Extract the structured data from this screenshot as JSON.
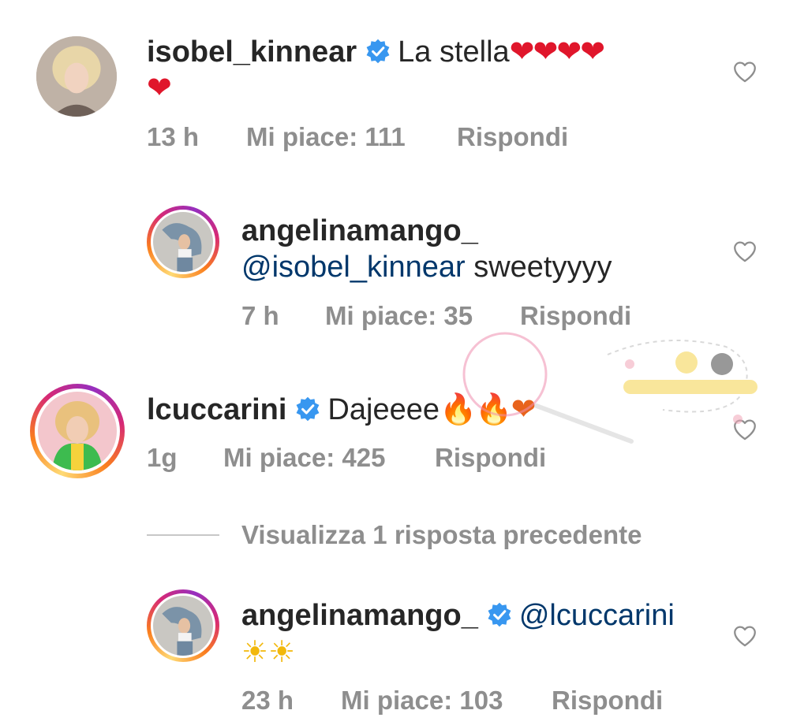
{
  "comments": [
    {
      "username": "isobel_kinnear",
      "verified": true,
      "text": "La stella",
      "emoji_line1": "❤❤❤❤",
      "emoji_line2": "❤",
      "time": "13 h",
      "likes": "Mi piace: 111",
      "reply": "Rispondi"
    },
    {
      "username": "angelinamango_",
      "verified": false,
      "mention": "@isobel_kinnear",
      "text": " sweetyyyy",
      "time": "7 h",
      "likes": "Mi piace: 35",
      "reply": "Rispondi"
    },
    {
      "username": "lcuccarini",
      "verified": true,
      "text": "Dajeeee",
      "emoji": "🔥🔥❤",
      "time": "1g",
      "likes": "Mi piace: 425",
      "reply": "Rispondi"
    },
    {
      "username": "angelinamango_",
      "verified": true,
      "mention": "@lcuccarini",
      "emoji": "☀☀",
      "time": "23 h",
      "likes": "Mi piace: 103",
      "reply": "Rispondi"
    }
  ],
  "view_previous": "Visualizza 1 risposta precedente",
  "colors": {
    "text": "#262626",
    "secondary": "#8e8e8e",
    "mention": "#00376b",
    "verified": "#3897f0",
    "heart": "#e0162b"
  },
  "icons": {
    "verified": "verified-badge-icon",
    "like": "heart-outline-icon"
  }
}
